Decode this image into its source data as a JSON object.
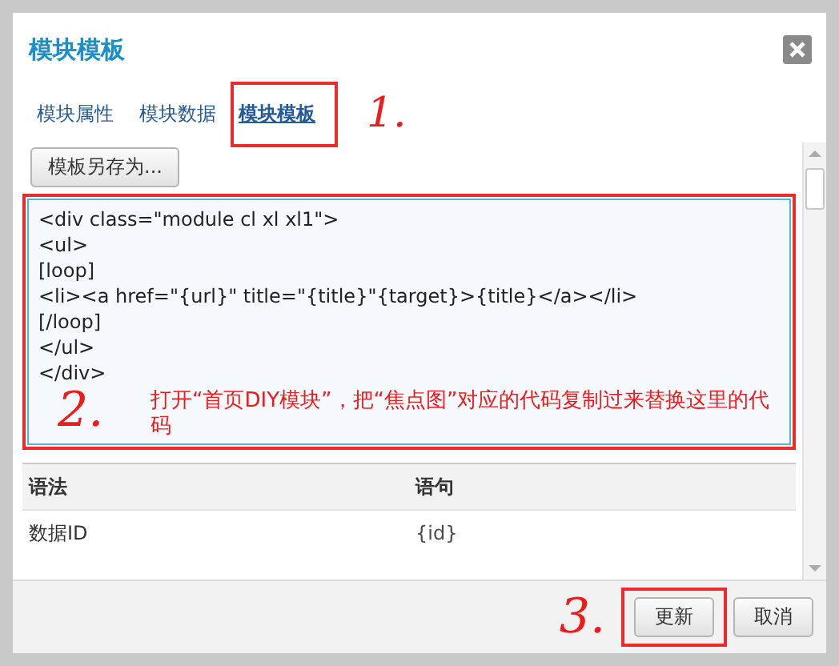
{
  "dialog": {
    "title": "模块模板"
  },
  "tabs": [
    {
      "label": "模块属性",
      "selected": false,
      "highlighted": false
    },
    {
      "label": "模块数据",
      "selected": false,
      "highlighted": false
    },
    {
      "label": "模块模板",
      "selected": true,
      "highlighted": true
    }
  ],
  "tabs_step": "1.",
  "save_as_button": "模板另存为...",
  "template_code": {
    "highlighted": true,
    "lines": [
      "<div class=\"module cl xl xl1\">",
      "<ul>",
      "[loop]",
      "<li><a href=\"{url}\" title=\"{title}\"{target}>{title}</a></li>",
      "[/loop]",
      "</ul>",
      "</div>"
    ],
    "step": "2.",
    "note": "打开“首页DIY模块”，把“焦点图”对应的代码复制过来替换这里的代码"
  },
  "syntax_table": {
    "columns": [
      "语法",
      "语句"
    ],
    "rows": [
      [
        "数据ID",
        "{id}"
      ]
    ]
  },
  "footer_step": "3.",
  "buttons": [
    {
      "label": "更新",
      "highlighted": true
    },
    {
      "label": "取消",
      "highlighted": false
    }
  ]
}
